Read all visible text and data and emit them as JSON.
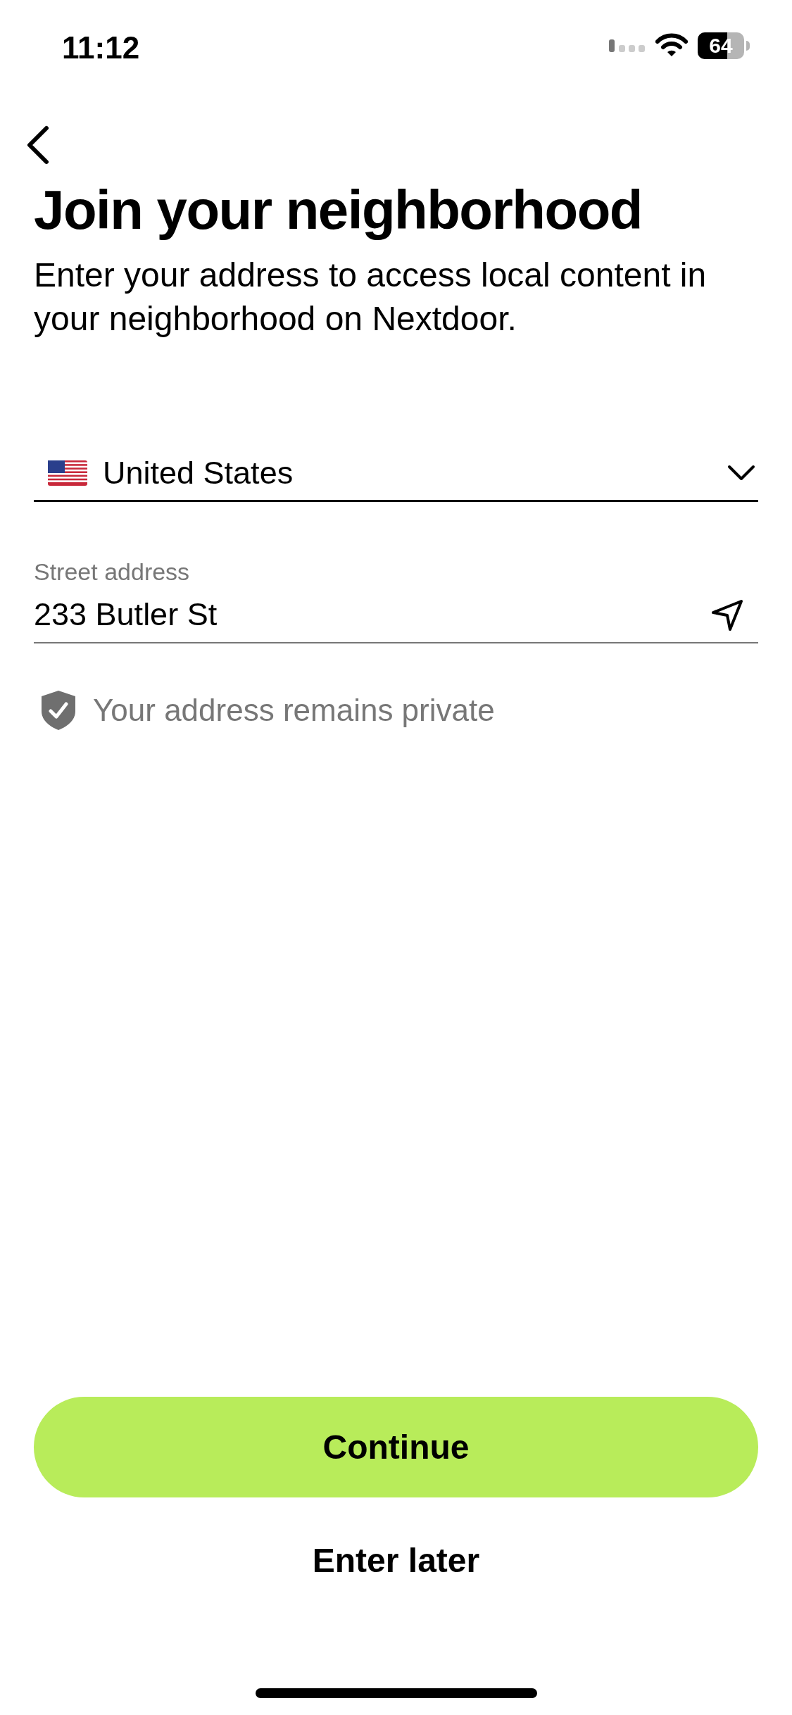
{
  "status_bar": {
    "time": "11:12",
    "battery": "64"
  },
  "title": "Join your neighborhood",
  "subtitle": "Enter your address to access local content in your neighborhood on Nextdoor.",
  "country_select": {
    "value": "United States"
  },
  "street_field": {
    "label": "Street address",
    "value": "233 Butler St"
  },
  "privacy_note": "Your address remains private",
  "buttons": [
    {
      "kind": "primary",
      "label": "Continue"
    },
    {
      "kind": "text",
      "label": "Enter later"
    }
  ]
}
